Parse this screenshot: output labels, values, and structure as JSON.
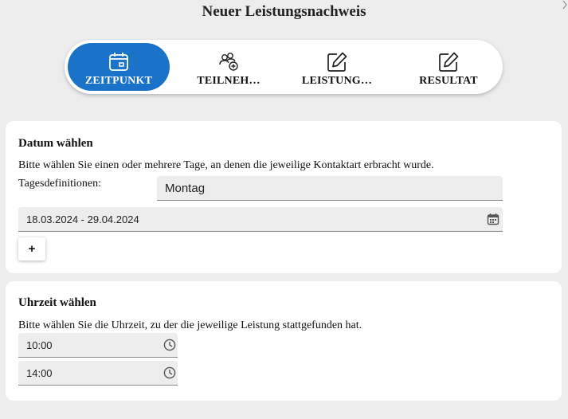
{
  "page": {
    "title": "Neuer Leistungsnachweis"
  },
  "stepper": {
    "steps": [
      {
        "label": "ZEITPUNKT",
        "icon": "calendar-icon",
        "active": true
      },
      {
        "label": "TEILNEH…",
        "icon": "participants-icon",
        "active": false
      },
      {
        "label": "LEISTUNG…",
        "icon": "edit-icon",
        "active": false
      },
      {
        "label": "RESULTAT",
        "icon": "edit-icon",
        "active": false
      }
    ],
    "active_color": "#1a73c9"
  },
  "date_section": {
    "title": "Datum wählen",
    "description": "Bitte wählen Sie einen oder mehrere Tage, an denen die jeweilige Kontaktart erbracht wurde.",
    "tagesdef_label": "Tagesdefinitionen:",
    "tagesdef_value": "Montag",
    "date_range": "18.03.2024 - 29.04.2024",
    "add_label": "+"
  },
  "time_section": {
    "title": "Uhrzeit wählen",
    "description": "Bitte wählen Sie die Uhrzeit, zu der die jeweilige Leistung stattgefunden hat.",
    "time_start": "10:00",
    "time_end": "14:00"
  }
}
